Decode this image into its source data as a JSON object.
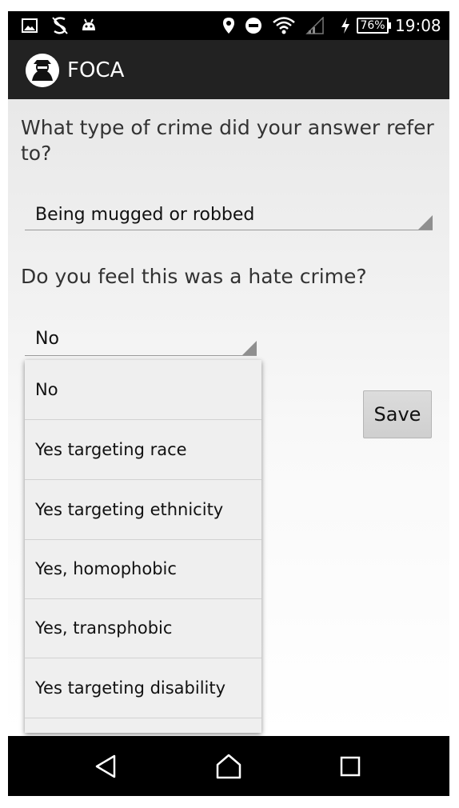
{
  "status_bar": {
    "icons": [
      "image-icon",
      "s-icon",
      "android-icon",
      "location-icon",
      "do-not-disturb-icon",
      "wifi-icon",
      "signal-icon",
      "charging-icon"
    ],
    "battery_percent": "76%",
    "time": "19:08"
  },
  "app": {
    "title": "FOCA",
    "logo_icon": "foca-logo-icon"
  },
  "form": {
    "question1": "What type of crime did your answer refer to?",
    "answer1": "Being mugged or robbed",
    "question2": "Do you feel this was a hate crime?",
    "answer2": "No",
    "save_label": "Save"
  },
  "dropdown": {
    "options": [
      "No",
      "Yes targeting race",
      "Yes targeting ethnicity",
      "Yes, homophobic",
      "Yes, transphobic",
      "Yes targeting disability"
    ]
  },
  "nav_bar": {
    "icons": [
      "back-icon",
      "home-icon",
      "recents-icon"
    ]
  },
  "colors": {
    "action_bar": "#222222",
    "status_bar": "#000000",
    "background": "#f2f2f2",
    "button": "#d6d6d6"
  }
}
